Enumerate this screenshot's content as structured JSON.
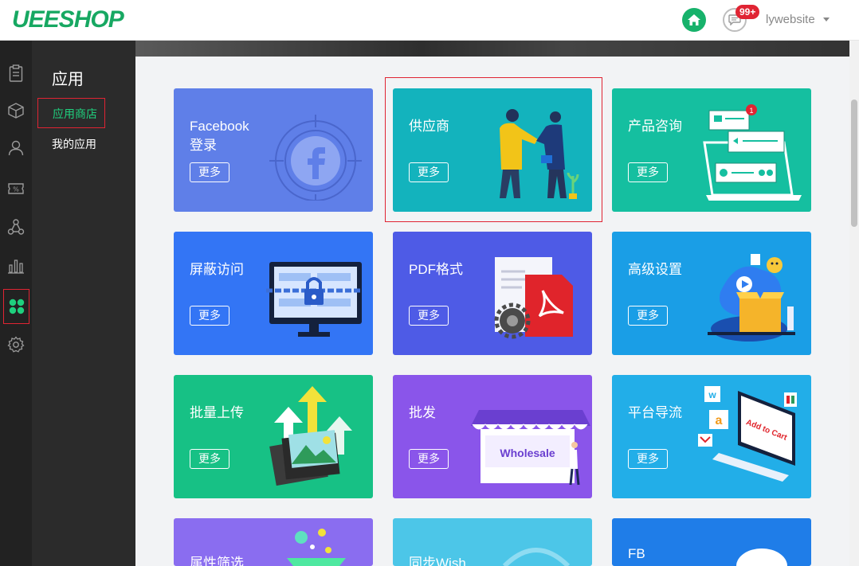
{
  "header": {
    "logo": "UEESHOP",
    "badge": "99+",
    "user": "lywebsite"
  },
  "rail": {
    "icons": [
      "clipboard-icon",
      "box-icon",
      "user-icon",
      "discount-icon",
      "network-icon",
      "chart-icon",
      "apps-icon",
      "gear-icon"
    ],
    "active_index": 6
  },
  "subnav": {
    "title": "应用",
    "items": [
      {
        "label": "应用商店",
        "active": true
      },
      {
        "label": "我的应用",
        "active": false
      }
    ]
  },
  "colors": {
    "accent": "#17a862",
    "sidebar_dark": "#222222",
    "subnav_dark": "#2b2b2b",
    "highlight": "#e02433"
  },
  "cards": [
    {
      "title": "Facebook 登录",
      "button": "更多",
      "color": "#5f7fe8",
      "icon": "facebook-icon"
    },
    {
      "title": "供应商",
      "button": "更多",
      "color": "#13b3bd",
      "icon": "handshake-icon"
    },
    {
      "title": "产品咨询",
      "button": "更多",
      "color": "#15bfa0",
      "icon": "chat-laptop-icon"
    },
    {
      "title": "屏蔽访问",
      "button": "更多",
      "color": "#3375f5",
      "icon": "locked-monitor-icon"
    },
    {
      "title": "PDF格式",
      "button": "更多",
      "color": "#4e5be6",
      "icon": "pdf-icon"
    },
    {
      "title": "高级设置",
      "button": "更多",
      "color": "#1a9ee6",
      "icon": "settings-box-icon"
    },
    {
      "title": "批量上传",
      "button": "更多",
      "color": "#17c185",
      "icon": "upload-photos-icon"
    },
    {
      "title": "批发",
      "button": "更多",
      "color": "#8a55ea",
      "icon": "wholesale-store-icon",
      "sign": "Wholesale"
    },
    {
      "title": "平台导流",
      "button": "更多",
      "color": "#22aee8",
      "icon": "add-to-cart-icon",
      "sign": "Add to Cart"
    },
    {
      "title": "属性筛选",
      "button": "",
      "color": "#8a6df0",
      "icon": "filter-funnel-icon"
    },
    {
      "title": "同步Wish",
      "button": "",
      "color": "#4cc6e8",
      "icon": "sync-icon"
    },
    {
      "title": "FB",
      "button": "",
      "color": "#1f7de8",
      "icon": "fb-icon"
    }
  ]
}
